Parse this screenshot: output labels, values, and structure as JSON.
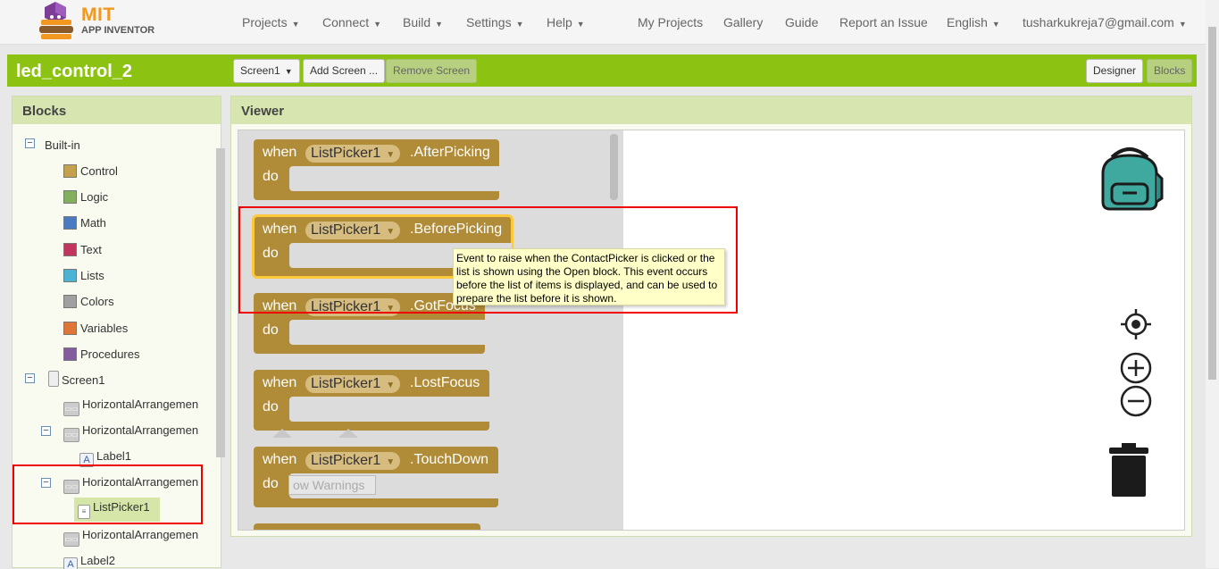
{
  "app": {
    "brand_line1": "MIT",
    "brand_line2": "APP INVENTOR"
  },
  "nav": {
    "projects": "Projects",
    "connect": "Connect",
    "build": "Build",
    "settings": "Settings",
    "help": "Help",
    "my_projects": "My Projects",
    "gallery": "Gallery",
    "guide": "Guide",
    "report": "Report an Issue",
    "language": "English",
    "account": "tusharkukreja7@gmail.com"
  },
  "project": {
    "name": "led_control_2",
    "screen": "Screen1",
    "add_screen": "Add Screen ...",
    "remove_screen": "Remove Screen",
    "designer": "Designer",
    "blocks": "Blocks"
  },
  "blocks_panel": {
    "title": "Blocks",
    "builtin": "Built-in",
    "items": [
      "Control",
      "Logic",
      "Math",
      "Text",
      "Lists",
      "Colors",
      "Variables",
      "Procedures"
    ],
    "colors": [
      "#c4a24d",
      "#82b05e",
      "#4a7ac0",
      "#c0365c",
      "#4cb3d5",
      "#a0a0a0",
      "#e07538",
      "#835c9e"
    ],
    "screen": "Screen1",
    "components": [
      "HorizontalArrangemen",
      "HorizontalArrangemen",
      "Label1",
      "HorizontalArrangemen",
      "ListPicker1",
      "HorizontalArrangemen",
      "Label2"
    ]
  },
  "viewer": {
    "title": "Viewer",
    "when": "when",
    "do": "do",
    "component": "ListPicker1",
    "events": [
      ".AfterPicking",
      ".BeforePicking",
      ".GotFocus",
      ".LostFocus",
      ".TouchDown"
    ],
    "tooltip": "Event to raise when the ContactPicker is clicked or the list is shown using the Open block. This event occurs before the list of items is displayed, and can be used to prepare the list before it is shown.",
    "warnings": "ow Warnings"
  }
}
